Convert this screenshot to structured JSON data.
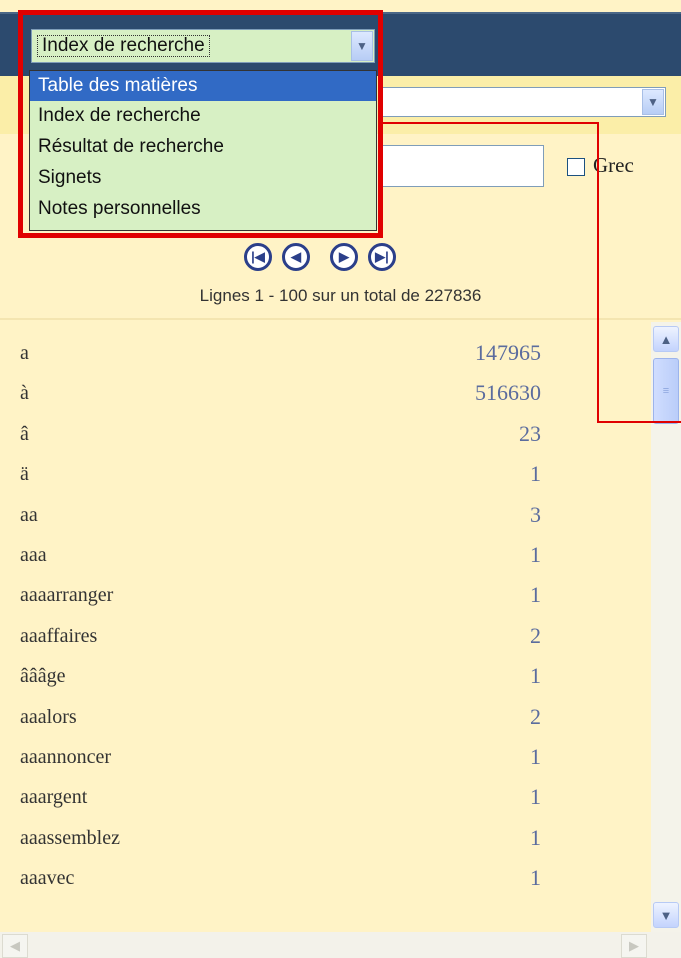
{
  "dropdown": {
    "selected": "Index de recherche",
    "options": [
      "Table des matières",
      "Index de recherche",
      "Résultat de recherche",
      "Signets",
      "Notes personnelles"
    ]
  },
  "search": {
    "greek_label": "Grec"
  },
  "pagination": {
    "first_icon": "first-page-icon",
    "prev_icon": "prev-page-icon",
    "next_icon": "next-page-icon",
    "last_icon": "last-page-icon",
    "info": "Lignes 1 - 100 sur un total de 227836"
  },
  "index_rows": [
    {
      "term": "a",
      "count": "147965"
    },
    {
      "term": "à",
      "count": "516630"
    },
    {
      "term": "â",
      "count": "23"
    },
    {
      "term": "ä",
      "count": "1"
    },
    {
      "term": "aa",
      "count": "3"
    },
    {
      "term": "aaa",
      "count": "1"
    },
    {
      "term": "aaaarranger",
      "count": "1"
    },
    {
      "term": "aaaffaires",
      "count": "2"
    },
    {
      "term": "âââge",
      "count": "1"
    },
    {
      "term": "aaalors",
      "count": "2"
    },
    {
      "term": "aaannoncer",
      "count": "1"
    },
    {
      "term": "aaargent",
      "count": "1"
    },
    {
      "term": "aaassemblez",
      "count": "1"
    },
    {
      "term": "aaavec",
      "count": "1"
    }
  ],
  "colors": {
    "header": "#2c4a6e",
    "panel": "#fff3c6",
    "highlight": "#e00000",
    "selected": "#316ac5",
    "dropdown_bg": "#d7f0c4"
  }
}
